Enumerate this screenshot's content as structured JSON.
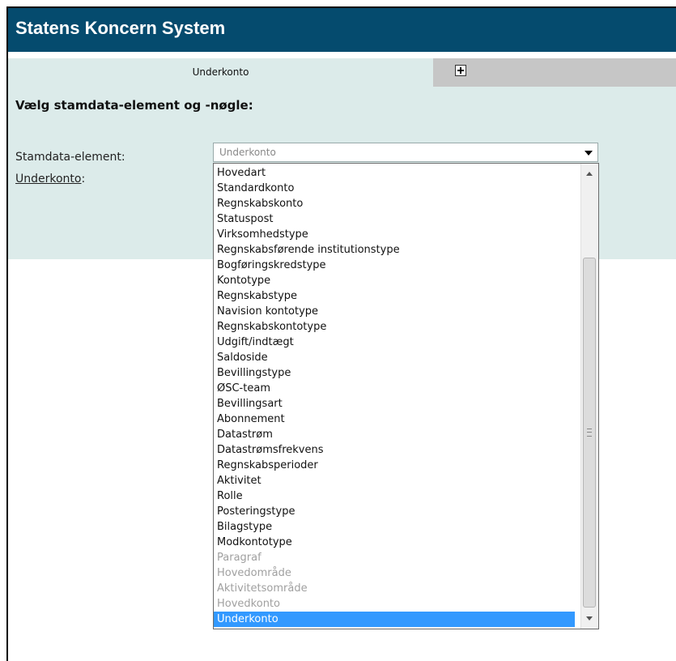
{
  "header": {
    "title": "Statens Koncern System"
  },
  "tabs": {
    "active_label": "Underkonto",
    "add_icon": "plus-icon"
  },
  "form": {
    "heading": "Vælg stamdata-element og -nøgle:",
    "stamdata_label": "Stamdata-element:",
    "underkonto_label": "Underkonto",
    "underkonto_colon": ":",
    "select_value": "Underkonto"
  },
  "options": [
    "Hovedart",
    "Standardkonto",
    "Regnskabskonto",
    "Statuspost",
    "Virksomhedstype",
    "Regnskabsførende institutionstype",
    "Bogføringskredstype",
    "Kontotype",
    "Regnskabstype",
    "Navision kontotype",
    "Regnskabskontotype",
    "Udgift/indtægt",
    "Saldoside",
    "Bevillingstype",
    "ØSC-team",
    "Bevillingsart",
    "Abonnement",
    "Datastrøm",
    "Datastrømsfrekvens",
    "Regnskabsperioder",
    "Aktivitet",
    "Rolle",
    "Posteringstype",
    "Bilagstype",
    "Modkontotype",
    "Paragraf",
    "Hovedområde",
    "Aktivitetsområde",
    "Hovedkonto",
    "Underkonto"
  ],
  "colors": {
    "header_bg": "#054b6e",
    "panel_bg": "#dcebea",
    "selected_bg": "#3399ff",
    "disabled_text": "#a0a0a0"
  }
}
